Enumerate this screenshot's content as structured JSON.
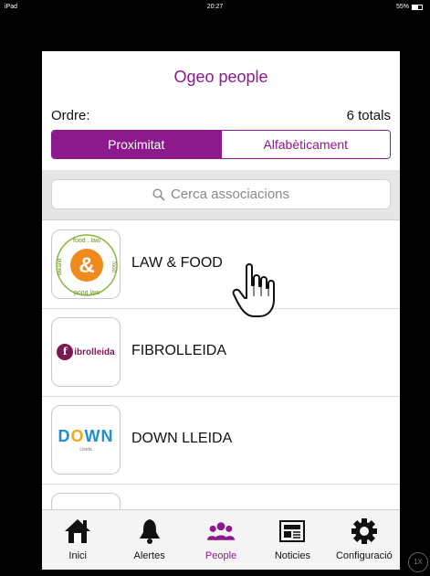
{
  "status_bar": {
    "carrier": "iPad",
    "time": "20:27",
    "battery": "55%"
  },
  "app": {
    "title": "Ogeo people",
    "order_label": "Ordre:",
    "totals": "6 totals",
    "segments": [
      {
        "label": "Proximitat",
        "selected": true
      },
      {
        "label": "Alfabèticament",
        "selected": false
      }
    ],
    "search": {
      "placeholder": "Cerca associacions",
      "icon": "search-icon"
    },
    "items": [
      {
        "name": "LAW & FOOD",
        "logo_text": "lawandfood",
        "logo_symbol": "&"
      },
      {
        "name": "FIBROLLEIDA",
        "logo_letter": "f",
        "logo_text": "ibrolleida"
      },
      {
        "name": "DOWN LLEIDA",
        "logo_text_d": "D",
        "logo_text_o": "O",
        "logo_text_wn": "WN",
        "logo_sub": "Lleida"
      }
    ],
    "tabs": [
      {
        "label": "Inici",
        "icon": "home-icon",
        "active": false
      },
      {
        "label": "Alertes",
        "icon": "bell-icon",
        "active": false
      },
      {
        "label": "People",
        "icon": "people-icon",
        "active": true
      },
      {
        "label": "Noticies",
        "icon": "news-icon",
        "active": false
      },
      {
        "label": "Configuració",
        "icon": "gear-icon",
        "active": false
      }
    ]
  },
  "zoom_button": "1X",
  "colors": {
    "accent": "#8d1a8d",
    "fibro": "#7a1a50",
    "down_blue": "#1f8fd0",
    "down_yellow": "#f2a818",
    "lawfood_orange": "#f08a1c"
  }
}
